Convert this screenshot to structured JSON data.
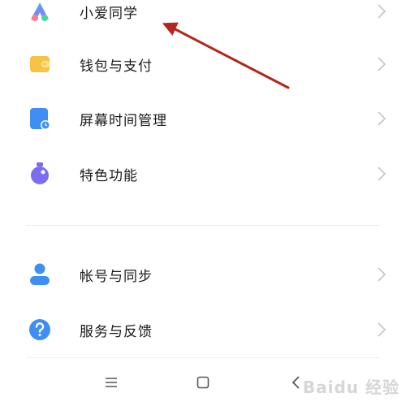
{
  "settings": {
    "items": [
      {
        "label": "小爱同学",
        "icon": "xiaoai-icon"
      },
      {
        "label": "钱包与支付",
        "icon": "wallet-icon"
      },
      {
        "label": "屏幕时间管理",
        "icon": "screen-time-icon"
      },
      {
        "label": "特色功能",
        "icon": "features-icon"
      },
      {
        "label": "帐号与同步",
        "icon": "account-icon"
      },
      {
        "label": "服务与反馈",
        "icon": "help-icon"
      }
    ]
  },
  "navbar": {
    "buttons": [
      "menu",
      "home",
      "back"
    ]
  },
  "watermark": {
    "text": "Baidu 经验"
  },
  "colors": {
    "arrow": "#b3261e",
    "wallet": "#f6c344",
    "screen_time": "#3f8ef3",
    "features": "#7b6cf2",
    "account": "#3f8ef3",
    "help": "#3f8ef3"
  }
}
